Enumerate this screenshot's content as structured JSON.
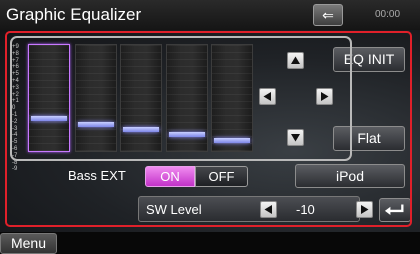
{
  "header": {
    "title": "Graphic Equalizer",
    "clock": "00:00",
    "back_icon": "back-arrow-icon"
  },
  "equalizer": {
    "scale_labels": [
      "+9",
      "+8",
      "+7",
      "+6",
      "+5",
      "+4",
      "+3",
      "+2",
      "+1",
      "0",
      "-1",
      "-2",
      "-3",
      "-4",
      "-5",
      "-6",
      "-7",
      "-8",
      "-9"
    ],
    "bands": [
      {
        "level": -4,
        "selected": true
      },
      {
        "level": -5,
        "selected": false
      },
      {
        "level": -6,
        "selected": false
      },
      {
        "level": -7,
        "selected": false
      },
      {
        "level": -8,
        "selected": false
      }
    ],
    "range": [
      -9,
      9
    ]
  },
  "controls": {
    "eq_init_label": "EQ INIT",
    "flat_label": "Flat",
    "source_label": "iPod"
  },
  "bass_ext": {
    "label": "Bass EXT",
    "on_label": "ON",
    "off_label": "OFF",
    "selected": "ON"
  },
  "sw_level": {
    "label": "SW Level",
    "value": "-10"
  },
  "footer": {
    "menu_label": "Menu"
  },
  "colors": {
    "accent": "#c232c8",
    "highlight_border": "#e0202a",
    "eq_bar": "#8f95f0"
  }
}
